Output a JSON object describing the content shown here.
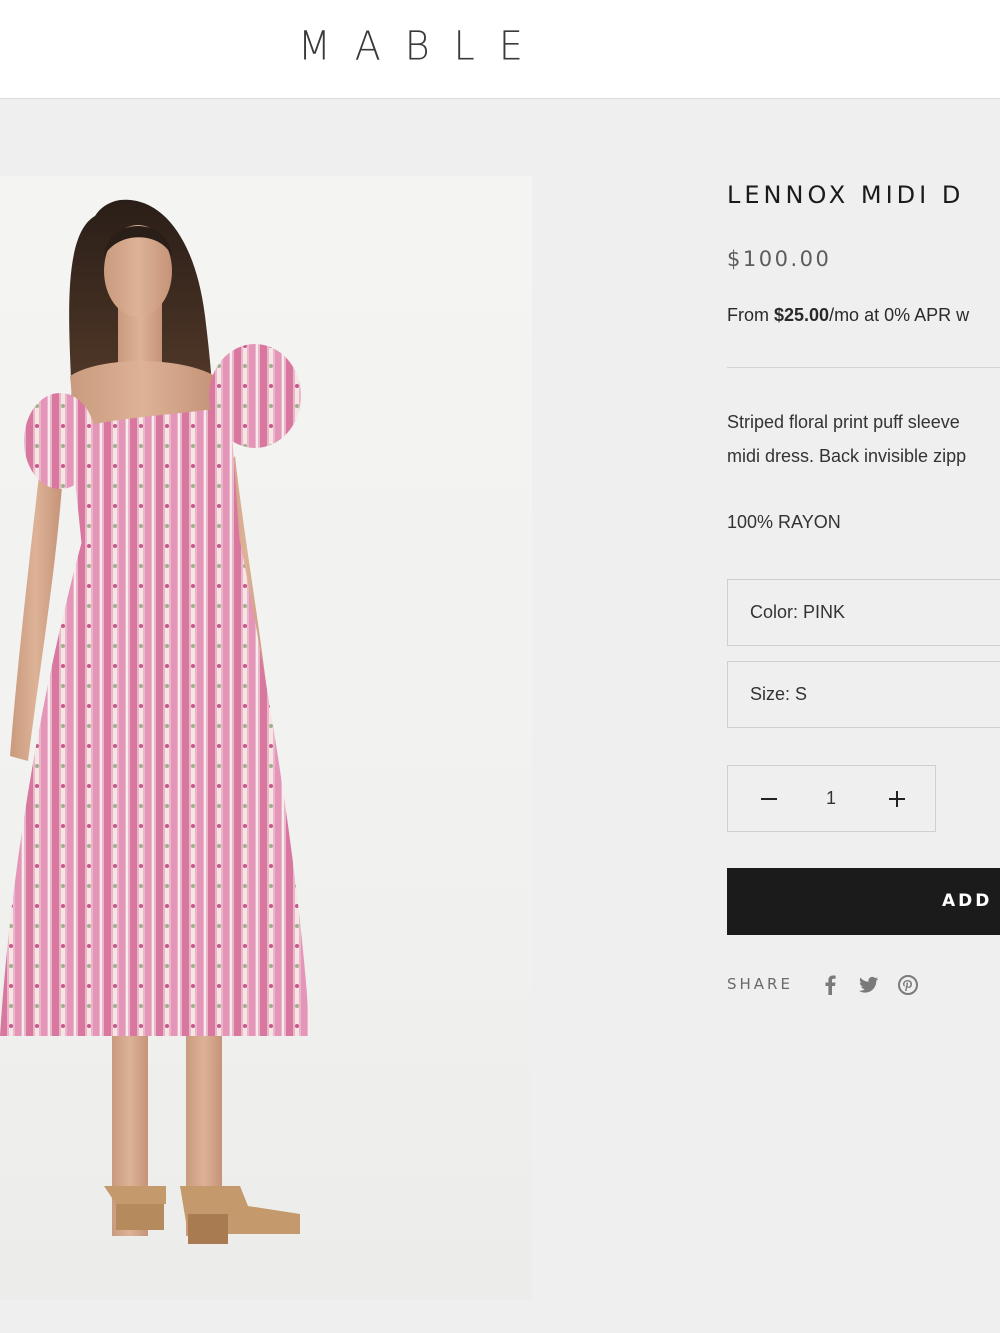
{
  "header": {
    "logo": "MABLE"
  },
  "product": {
    "title": "LENNOX MIDI D",
    "price": "$100.00",
    "financing": {
      "prefix": "From ",
      "amount": "$25.00",
      "suffix": "/mo at 0% APR w"
    },
    "description_line1": "Striped floral print puff sleeve",
    "description_line2": "midi dress. Back invisible zipp",
    "material": "100% RAYON",
    "color_option": "Color: PINK",
    "size_option": "Size: S",
    "quantity": "1",
    "add_to_cart": "ADD",
    "share_label": "SHARE"
  },
  "icons": [
    "minus-icon",
    "plus-icon",
    "facebook-icon",
    "twitter-icon",
    "pinterest-icon"
  ],
  "colors": {
    "background": "#efefef",
    "button": "#1c1b1b",
    "dress_pink": "#e8a9c4"
  }
}
